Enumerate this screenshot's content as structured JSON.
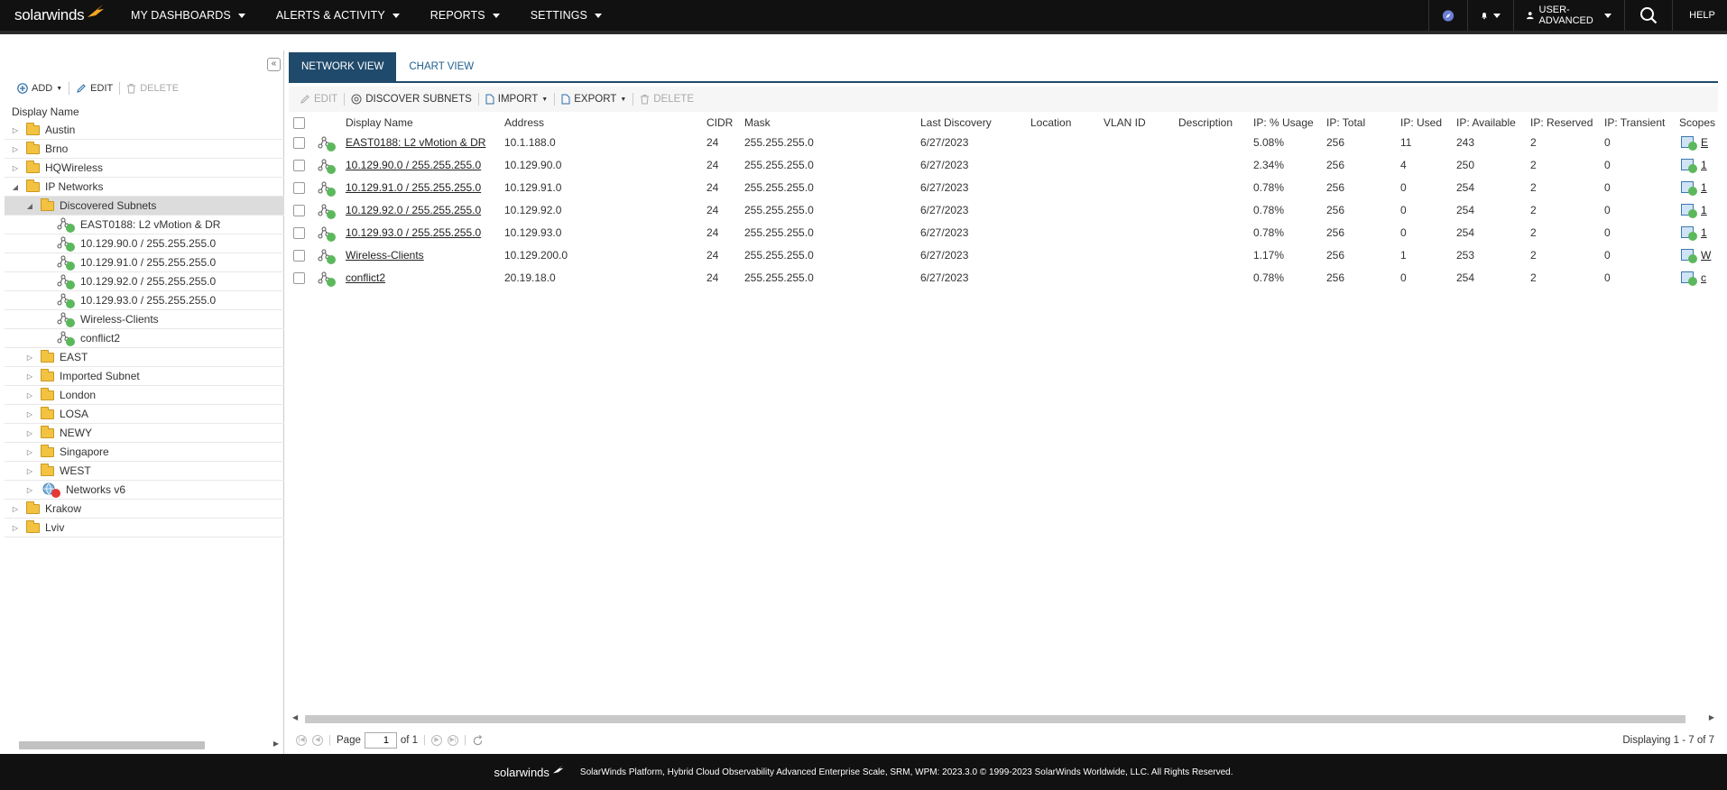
{
  "nav": {
    "logo": "solarwinds",
    "items": [
      "MY DASHBOARDS",
      "ALERTS & ACTIVITY",
      "REPORTS",
      "SETTINGS"
    ],
    "user": "USER-ADVANCED",
    "help": "HELP"
  },
  "left": {
    "toolbar": {
      "add": "ADD",
      "edit": "EDIT",
      "delete": "DELETE"
    },
    "tree_header": "Display Name",
    "tree": [
      {
        "label": "Austin",
        "level": 0,
        "type": "folder",
        "expander": "collapsed"
      },
      {
        "label": "Brno",
        "level": 0,
        "type": "folder",
        "expander": "collapsed"
      },
      {
        "label": "HQWireless",
        "level": 0,
        "type": "folder",
        "expander": "collapsed"
      },
      {
        "label": "IP Networks",
        "level": 0,
        "type": "folder-open",
        "expander": "expanded"
      },
      {
        "label": "Discovered Subnets",
        "level": 1,
        "type": "folder-open",
        "expander": "expanded",
        "selected": true
      },
      {
        "label": "EAST0188: L2 vMotion & DR",
        "level": 2,
        "type": "subnet"
      },
      {
        "label": "10.129.90.0 / 255.255.255.0",
        "level": 2,
        "type": "subnet"
      },
      {
        "label": "10.129.91.0 / 255.255.255.0",
        "level": 2,
        "type": "subnet"
      },
      {
        "label": "10.129.92.0 / 255.255.255.0",
        "level": 2,
        "type": "subnet"
      },
      {
        "label": "10.129.93.0 / 255.255.255.0",
        "level": 2,
        "type": "subnet"
      },
      {
        "label": "Wireless-Clients",
        "level": 2,
        "type": "subnet"
      },
      {
        "label": "conflict2",
        "level": 2,
        "type": "subnet"
      },
      {
        "label": "EAST",
        "level": 1,
        "type": "folder",
        "expander": "collapsed"
      },
      {
        "label": "Imported Subnet",
        "level": 1,
        "type": "folder",
        "expander": "collapsed"
      },
      {
        "label": "London",
        "level": 1,
        "type": "folder",
        "expander": "collapsed"
      },
      {
        "label": "LOSA",
        "level": 1,
        "type": "folder",
        "expander": "collapsed"
      },
      {
        "label": "NEWY",
        "level": 1,
        "type": "folder",
        "expander": "collapsed"
      },
      {
        "label": "Singapore",
        "level": 1,
        "type": "folder",
        "expander": "collapsed"
      },
      {
        "label": "WEST",
        "level": 1,
        "type": "folder",
        "expander": "collapsed"
      },
      {
        "label": "Networks v6",
        "level": 1,
        "type": "globe",
        "expander": "collapsed"
      },
      {
        "label": "Krakow",
        "level": 0,
        "type": "folder",
        "expander": "collapsed"
      },
      {
        "label": "Lviv",
        "level": 0,
        "type": "folder",
        "expander": "collapsed"
      }
    ]
  },
  "right": {
    "tabs": [
      "NETWORK VIEW",
      "CHART VIEW"
    ],
    "toolbar": {
      "edit": "EDIT",
      "discover": "DISCOVER SUBNETS",
      "import": "IMPORT",
      "export": "EXPORT",
      "delete": "DELETE"
    },
    "columns": [
      "Display Name",
      "Address",
      "CIDR",
      "Mask",
      "Last Discovery",
      "Location",
      "VLAN ID",
      "Description",
      "IP: % Usage",
      "IP: Total",
      "IP: Used",
      "IP: Available",
      "IP: Reserved",
      "IP: Transient",
      "Scopes"
    ],
    "rows": [
      {
        "name": "EAST0188: L2 vMotion & DR",
        "address": "10.1.188.0",
        "cidr": "24",
        "mask": "255.255.255.0",
        "last": "6/27/2023",
        "location": "",
        "vlan": "",
        "desc": "",
        "usage": "5.08%",
        "total": "256",
        "used": "11",
        "available": "243",
        "reserved": "2",
        "transient": "0",
        "scope": "E"
      },
      {
        "name": "10.129.90.0 / 255.255.255.0",
        "address": "10.129.90.0",
        "cidr": "24",
        "mask": "255.255.255.0",
        "last": "6/27/2023",
        "location": "",
        "vlan": "",
        "desc": "",
        "usage": "2.34%",
        "total": "256",
        "used": "4",
        "available": "250",
        "reserved": "2",
        "transient": "0",
        "scope": "1"
      },
      {
        "name": "10.129.91.0 / 255.255.255.0",
        "address": "10.129.91.0",
        "cidr": "24",
        "mask": "255.255.255.0",
        "last": "6/27/2023",
        "location": "",
        "vlan": "",
        "desc": "",
        "usage": "0.78%",
        "total": "256",
        "used": "0",
        "available": "254",
        "reserved": "2",
        "transient": "0",
        "scope": "1"
      },
      {
        "name": "10.129.92.0 / 255.255.255.0",
        "address": "10.129.92.0",
        "cidr": "24",
        "mask": "255.255.255.0",
        "last": "6/27/2023",
        "location": "",
        "vlan": "",
        "desc": "",
        "usage": "0.78%",
        "total": "256",
        "used": "0",
        "available": "254",
        "reserved": "2",
        "transient": "0",
        "scope": "1"
      },
      {
        "name": "10.129.93.0 / 255.255.255.0",
        "address": "10.129.93.0",
        "cidr": "24",
        "mask": "255.255.255.0",
        "last": "6/27/2023",
        "location": "",
        "vlan": "",
        "desc": "",
        "usage": "0.78%",
        "total": "256",
        "used": "0",
        "available": "254",
        "reserved": "2",
        "transient": "0",
        "scope": "1"
      },
      {
        "name": "Wireless-Clients",
        "address": "10.129.200.0",
        "cidr": "24",
        "mask": "255.255.255.0",
        "last": "6/27/2023",
        "location": "",
        "vlan": "",
        "desc": "",
        "usage": "1.17%",
        "total": "256",
        "used": "1",
        "available": "253",
        "reserved": "2",
        "transient": "0",
        "scope": "W"
      },
      {
        "name": "conflict2",
        "address": "20.19.18.0",
        "cidr": "24",
        "mask": "255.255.255.0",
        "last": "6/27/2023",
        "location": "",
        "vlan": "",
        "desc": "",
        "usage": "0.78%",
        "total": "256",
        "used": "0",
        "available": "254",
        "reserved": "2",
        "transient": "0",
        "scope": "c"
      }
    ],
    "pager": {
      "page_label": "Page",
      "page_value": "1",
      "of_label": "of 1",
      "displaying": "Displaying 1 - 7 of 7"
    }
  },
  "footer": {
    "logo": "solarwinds",
    "text": "SolarWinds Platform, Hybrid Cloud Observability Advanced Enterprise Scale, SRM, WPM: 2023.3.0 © 1999-2023 SolarWinds Worldwide, LLC. All Rights Reserved."
  },
  "colors": {
    "nav_bg": "#111111",
    "tab_active": "#204a6b",
    "status_green": "#5cb85c",
    "status_red": "#e53935",
    "folder": "#f3c241"
  }
}
